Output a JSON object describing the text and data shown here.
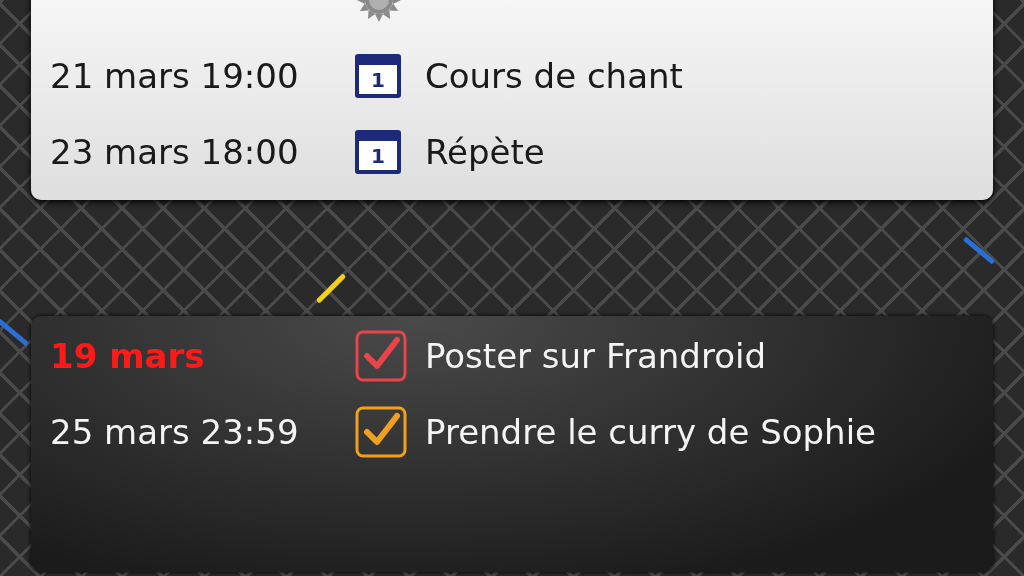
{
  "agenda": [
    {
      "kind": "weather"
    },
    {
      "kind": "calendar",
      "date": "21 mars 19:00",
      "icon_label": "1",
      "text": "Cours de chant"
    },
    {
      "kind": "calendar",
      "date": "23 mars 18:00",
      "icon_label": "1",
      "text": "Répète"
    }
  ],
  "tasks": [
    {
      "date": "19 mars",
      "overdue": true,
      "checked": true,
      "color": "#e8454a",
      "text": "Poster sur Frandroid"
    },
    {
      "date": "25 mars 23:59",
      "overdue": false,
      "checked": true,
      "color": "#f0a020",
      "text": "Prendre le curry de Sophie"
    }
  ]
}
